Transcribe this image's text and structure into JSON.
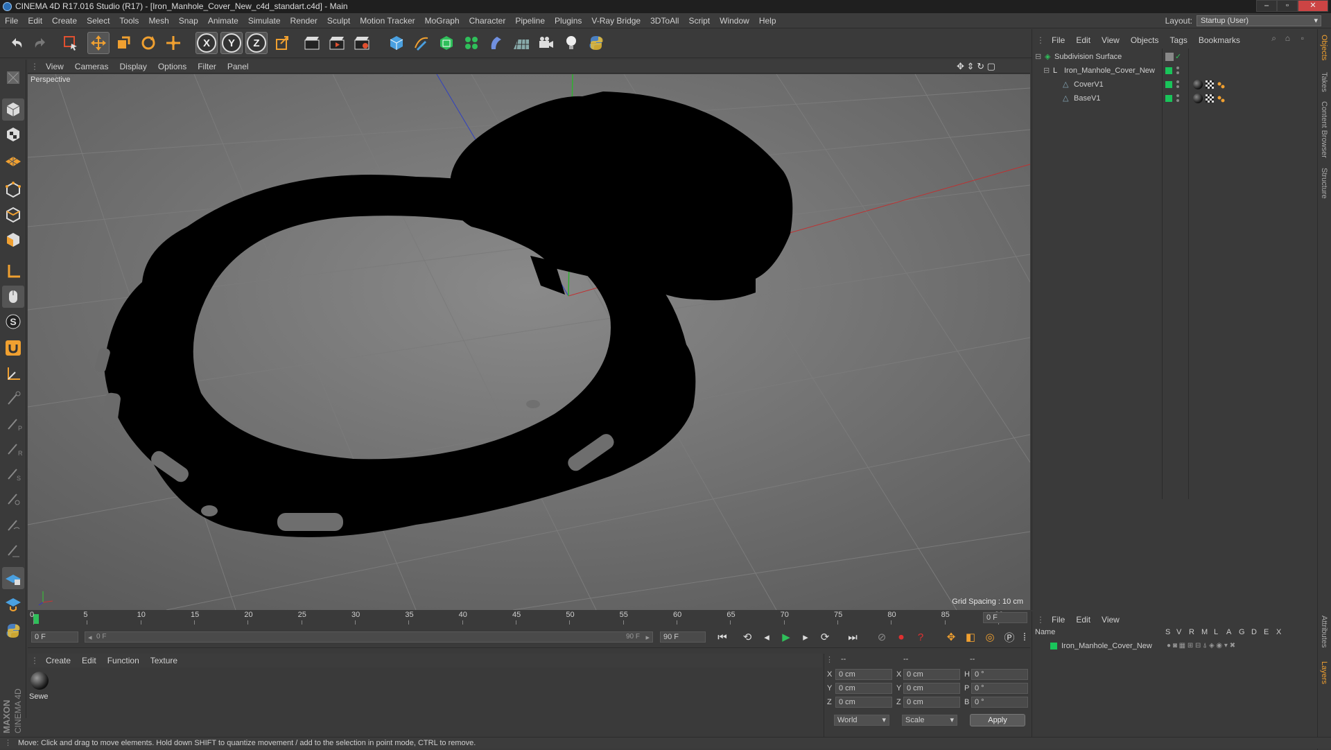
{
  "window": {
    "title": "CINEMA 4D R17.016 Studio (R17) - [Iron_Manhole_Cover_New_c4d_standart.c4d] - Main"
  },
  "menubar": {
    "items": [
      "File",
      "Edit",
      "Create",
      "Select",
      "Tools",
      "Mesh",
      "Snap",
      "Animate",
      "Simulate",
      "Render",
      "Sculpt",
      "Motion Tracker",
      "MoGraph",
      "Character",
      "Pipeline",
      "Plugins",
      "V-Ray Bridge",
      "3DToAll",
      "Script",
      "Window",
      "Help"
    ],
    "layout_label": "Layout:",
    "layout_value": "Startup (User)"
  },
  "viewport": {
    "menu": [
      "View",
      "Cameras",
      "Display",
      "Options",
      "Filter",
      "Panel"
    ],
    "label": "Perspective",
    "grid_spacing": "Grid Spacing : 10 cm"
  },
  "object_manager": {
    "menu": [
      "File",
      "Edit",
      "View",
      "Objects",
      "Tags",
      "Bookmarks"
    ],
    "objects": [
      {
        "name": "Subdivision Surface"
      },
      {
        "name": "Iron_Manhole_Cover_New"
      },
      {
        "name": "CoverV1"
      },
      {
        "name": "BaseV1"
      }
    ]
  },
  "timeline": {
    "ticks": [
      "0",
      "5",
      "10",
      "15",
      "20",
      "25",
      "30",
      "35",
      "40",
      "45",
      "50",
      "55",
      "60",
      "65",
      "70",
      "75",
      "80",
      "85",
      "90"
    ],
    "current_frame": "0 F",
    "start_field": "0 F",
    "range_start": "0 F",
    "range_end": "90 F",
    "end_field": "90 F"
  },
  "material_manager": {
    "menu": [
      "Create",
      "Edit",
      "Function",
      "Texture"
    ],
    "materials": [
      {
        "name": "Sewe"
      }
    ]
  },
  "coordinates": {
    "header": [
      "--",
      "--",
      "--"
    ],
    "rows": [
      {
        "a": "X",
        "av": "0 cm",
        "b": "X",
        "bv": "0 cm",
        "c": "H",
        "cv": "0 °"
      },
      {
        "a": "Y",
        "av": "0 cm",
        "b": "Y",
        "bv": "0 cm",
        "c": "P",
        "cv": "0 °"
      },
      {
        "a": "Z",
        "av": "0 cm",
        "b": "Z",
        "bv": "0 cm",
        "c": "B",
        "cv": "0 °"
      }
    ],
    "space": "World",
    "mode": "Scale",
    "apply": "Apply"
  },
  "attributes": {
    "menu": [
      "File",
      "Edit",
      "View"
    ],
    "columns": [
      "Name",
      "S",
      "V",
      "R",
      "M",
      "L",
      "A",
      "G",
      "D",
      "E",
      "X"
    ],
    "row_name": "Iron_Manhole_Cover_New"
  },
  "side_tabs": [
    "Objects",
    "Takes",
    "Content Browser",
    "Structure",
    "Attributes",
    "Layers"
  ],
  "status": "Move: Click and drag to move elements. Hold down SHIFT to quantize movement / add to the selection in point mode, CTRL to remove.",
  "colors": {
    "accent": "#f0a030",
    "green": "#19c45a",
    "viewport_bg": "#6b6b6b"
  }
}
